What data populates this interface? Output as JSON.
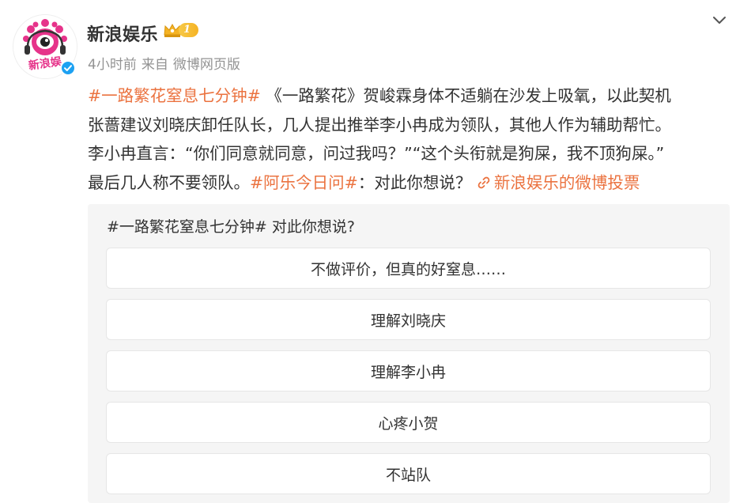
{
  "post": {
    "username": "新浪娱乐",
    "badge_level": "1",
    "avatar_text": "新浪娱",
    "meta": {
      "time": "4小时前",
      "from_label": "来自",
      "source": "微博网页版"
    },
    "text": {
      "topic1": "#一路繁花窒息七分钟#",
      "line1_rest": " 《一路繁花》贺峻霖身体不适躺在沙发上吸氧，以此契机",
      "line2": "张蔷建议刘晓庆卸任队长，几人提出推举李小冉成为领队，其他人作为辅助帮忙。",
      "line3": "李小冉直言：“你们同意就同意，问过我吗？”“这个头衔就是狗屎，我不顶狗屎。”",
      "line4_start": "最后几人称不要领队。",
      "topic2": "#阿乐今日问#",
      "line4_mid": "：对此你想说？ ",
      "link_label": "新浪娱乐的微博投票"
    }
  },
  "vote": {
    "question": "#一路繁花窒息七分钟# 对此你想说?",
    "options": [
      "不做评价，但真的好窒息……",
      "理解刘晓庆",
      "理解李小冉",
      "心疼小贺",
      "不站队"
    ]
  },
  "colors": {
    "accent": "#eb7340",
    "meta": "#939393",
    "text": "#333333",
    "card_bg": "#f5f5f5",
    "verified": "#1da1f2",
    "badge": "#f5b324"
  },
  "icons": {
    "chevron": "chevron-down-icon",
    "verified": "verified-icon",
    "crown": "crown-icon",
    "link": "link-icon"
  }
}
